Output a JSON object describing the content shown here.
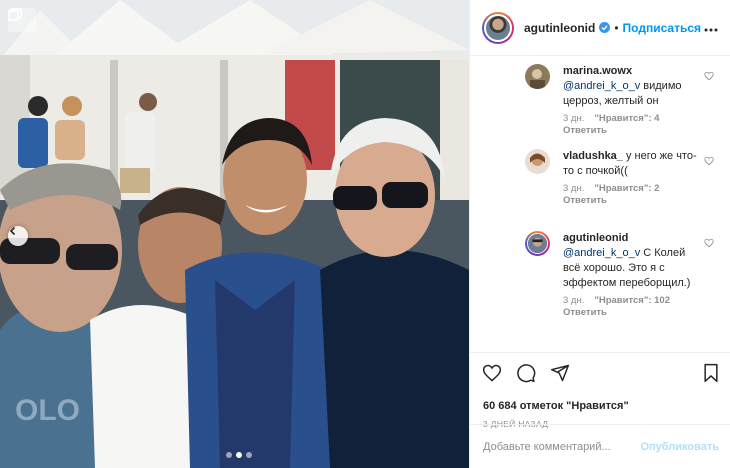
{
  "post": {
    "username": "agutinleonid",
    "follow_label": "Подписаться",
    "separator": "•",
    "likes_text": "60 684 отметок \"Нравится\"",
    "date_text": "3 ДНЕЙ НАЗАД"
  },
  "comments": [
    {
      "user": "marina.wowx",
      "mention": "@andrei_k_o_v",
      "text": " видимо церроз, желтый он",
      "time": "3 дн.",
      "likes": "\"Нравится\": 4",
      "reply": "Ответить"
    },
    {
      "user": "vladushka_",
      "mention": "",
      "text": " у него же что-то с почкой((",
      "time": "3 дн.",
      "likes": "\"Нравится\": 2",
      "reply": "Ответить"
    },
    {
      "user": "agutinleonid",
      "mention": "@andrei_k_o_v",
      "text": " С Колей всё хорошо. Это я с эффектом переборщил.)",
      "time": "3 дн.",
      "likes": "\"Нравится\": 102",
      "reply": "Ответить"
    }
  ],
  "add_comment": {
    "placeholder": "Добавьте комментарий...",
    "publish_label": "Опубликовать"
  },
  "colors": {
    "accent": "#0095f6",
    "verified": "#3897f0",
    "muted": "#8e8e8e",
    "publish_disabled": "#b2dffc"
  },
  "icons": {
    "header_more": "more-icon",
    "like": "heart-icon",
    "comment": "comment-icon",
    "share": "share-icon",
    "save": "bookmark-icon",
    "prev": "chevron-left-icon"
  },
  "carousel": {
    "total": 3,
    "active": 2
  }
}
